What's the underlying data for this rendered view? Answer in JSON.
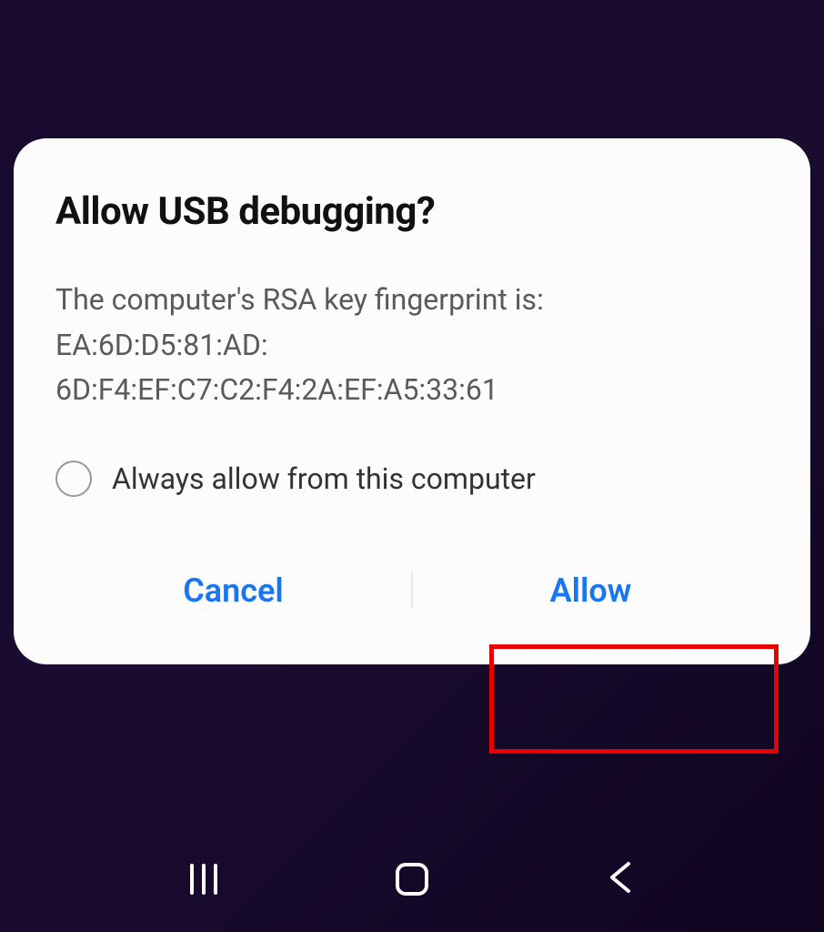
{
  "dialog": {
    "title": "Allow USB debugging?",
    "message": "The computer's RSA key fingerprint is:\nEA:6D:D5:81:AD:\n6D:F4:EF:C7:C2:F4:2A:EF:A5:33:61",
    "checkbox_label": "Always allow from this computer",
    "cancel_label": "Cancel",
    "allow_label": "Allow"
  }
}
